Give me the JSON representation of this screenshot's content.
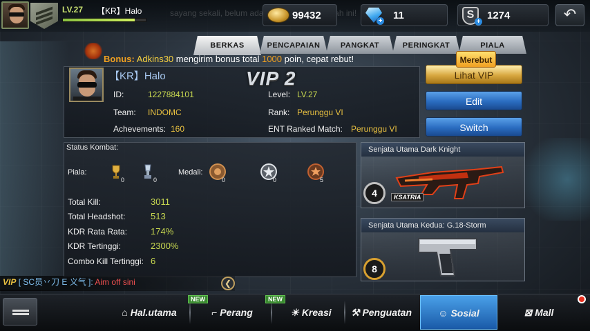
{
  "player": {
    "level": "LV.27",
    "name": "【KR】Halo",
    "xp_fraction": 0.87
  },
  "ghost_marquee": "sayang sekali, belum ada yang merebut hadiah ini!",
  "currency": {
    "gold": "99432",
    "diamond": "11",
    "s_points": "1274"
  },
  "back_icon": "back-arrow-icon",
  "tabs": [
    {
      "label": "BERKAS"
    },
    {
      "label": "PENCAPAIAN"
    },
    {
      "label": "PANGKAT"
    },
    {
      "label": "PERINGKAT"
    },
    {
      "label": "PIALA"
    }
  ],
  "bonus": {
    "prefix": "Bonus:",
    "sender": "Adkins30",
    "text1": "mengirim bonus total",
    "amount": "1000",
    "text2": "poin, cepat rebut!"
  },
  "merebut_label": "Merebut",
  "profile": {
    "name": "【KR】Halo",
    "vip": "VIP 2",
    "id_label": "ID:",
    "id_value": "1227884101",
    "level_label": "Level:",
    "level_value": "LV.27",
    "team_label": "Team:",
    "team_value": "INDOMC",
    "rank_label": "Rank:",
    "rank_value": "Perunggu VI",
    "ach_label": "Achevements:",
    "ach_value": "160",
    "ent_label": "ENT Ranked Match:",
    "ent_value": "Perunggu VI"
  },
  "side_buttons": {
    "vip": "Lihat VIP",
    "edit": "Edit",
    "switch": "Switch"
  },
  "stats": {
    "title": "Status Kombat:",
    "piala_label": "Piala:",
    "medali_label": "Medali:",
    "piala_counts": [
      "0",
      "0"
    ],
    "medali_counts": [
      "0",
      "0",
      "5"
    ],
    "rows": [
      {
        "label": "Total Kill:",
        "value": "3011"
      },
      {
        "label": "Total Headshot:",
        "value": "513"
      },
      {
        "label": "KDR Rata Rata:",
        "value": "174%"
      },
      {
        "label": "KDR Tertinggi:",
        "value": "2300%"
      },
      {
        "label": "Combo Kill Tertinggi:",
        "value": "6"
      }
    ]
  },
  "weapons": [
    {
      "title": "Senjata Utama Dark Knight",
      "badge": "4",
      "tag": "KSATRIA"
    },
    {
      "title": "Senjata Utama Kedua: G.18-Storm",
      "badge": "8"
    }
  ],
  "chat": {
    "vip": "VIP",
    "channel": "[ SC员丷刀 E 义气 ]:",
    "message": "Aim off sini"
  },
  "nav": [
    {
      "label": "Hal.utama",
      "icon": "home-icon",
      "new": false
    },
    {
      "label": "Perang",
      "icon": "pistol-icon",
      "new": true,
      "new_label": "NEW"
    },
    {
      "label": "Kreasi",
      "icon": "bulb-icon",
      "new": true,
      "new_label": "NEW"
    },
    {
      "label": "Penguatan",
      "icon": "hammer-icon",
      "new": false
    },
    {
      "label": "Sosial",
      "icon": "people-icon",
      "new": false,
      "active": true
    },
    {
      "label": "Mall",
      "icon": "cart-icon",
      "new": false
    }
  ],
  "colors": {
    "accent_blue": "#2a6cc0",
    "gold": "#d8a840",
    "value_green": "#c8d850"
  }
}
